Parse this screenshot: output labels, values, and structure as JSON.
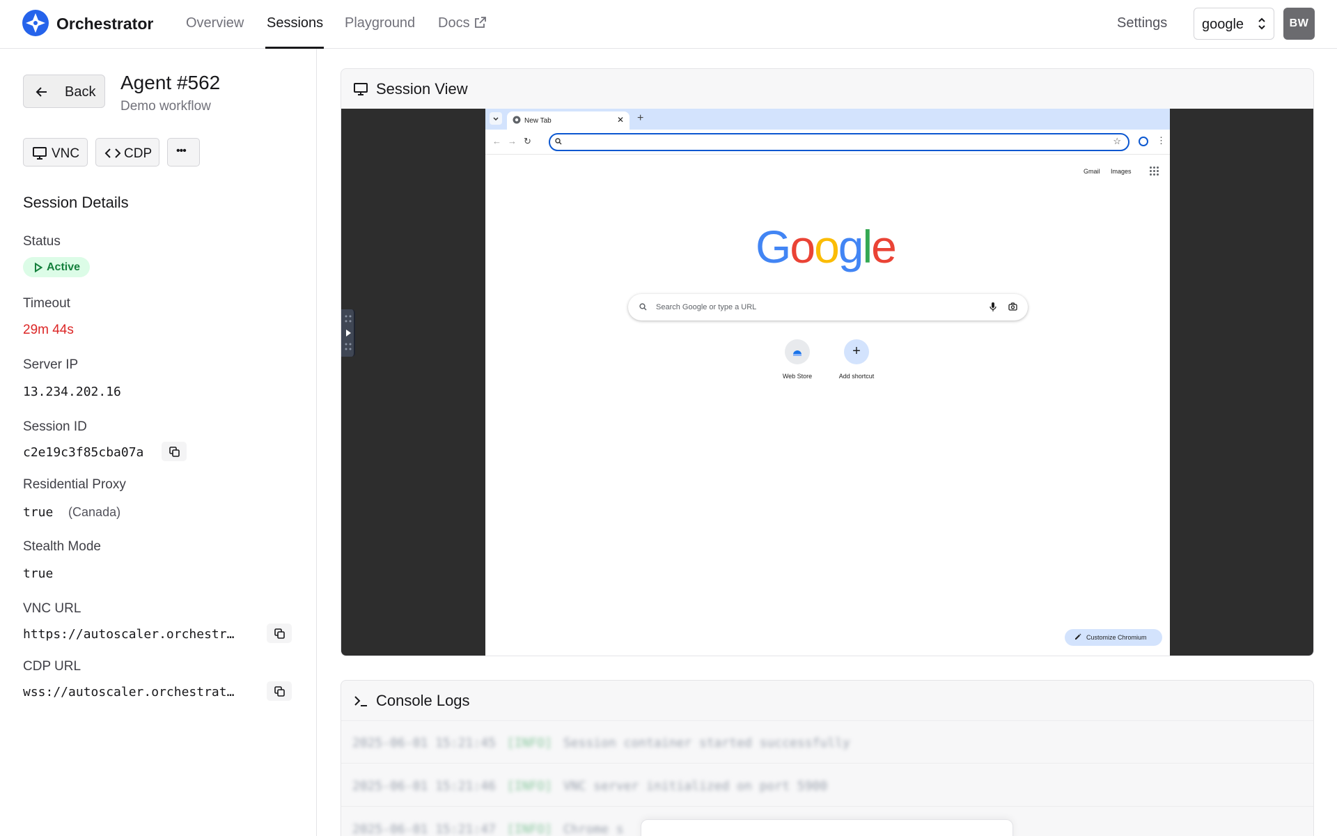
{
  "app": {
    "name": "Orchestrator",
    "brand_color": "#2563eb"
  },
  "nav": {
    "links": [
      {
        "label": "Overview"
      },
      {
        "label": "Sessions"
      },
      {
        "label": "Playground"
      },
      {
        "label": "Docs"
      }
    ],
    "active": "Sessions",
    "settings_label": "Settings",
    "org_select_value": "google",
    "avatar_initials": "BW"
  },
  "sidebar": {
    "back_label": "Back",
    "agent_title": "Agent #562",
    "agent_subtitle": "Demo workflow",
    "tools": {
      "vnc_label": "VNC",
      "cdp_label": "CDP",
      "more_label": "•••"
    },
    "section_title": "Session Details",
    "fields": {
      "status": {
        "label": "Status",
        "value": "Active",
        "color": "#15803d"
      },
      "timeout": {
        "label": "Timeout",
        "value": "29m 44s",
        "color": "#dc2626"
      },
      "server_ip": {
        "label": "Server IP",
        "value": "13.234.202.16"
      },
      "session_id": {
        "label": "Session ID",
        "value": "c2e19c3f85cba07a"
      },
      "proxy": {
        "label": "Residential Proxy",
        "value": "true",
        "note": "(Canada)"
      },
      "stealth": {
        "label": "Stealth Mode",
        "value": "true"
      },
      "vnc_url": {
        "label": "VNC URL",
        "value": "https://autoscaler.orchestr…"
      },
      "cdp_url": {
        "label": "CDP URL",
        "value": "wss://autoscaler.orchestrat…"
      }
    }
  },
  "session_view": {
    "title": "Session View",
    "browser": {
      "tab_title": "New Tab",
      "new_tab_symbol": "+",
      "ntp_links": [
        "Gmail",
        "Images"
      ],
      "logo_letters": [
        {
          "ch": "G",
          "color": "#4285f4"
        },
        {
          "ch": "o",
          "color": "#ea4335"
        },
        {
          "ch": "o",
          "color": "#fbbc05"
        },
        {
          "ch": "g",
          "color": "#4285f4"
        },
        {
          "ch": "l",
          "color": "#34a853"
        },
        {
          "ch": "e",
          "color": "#ea4335"
        }
      ],
      "search_placeholder": "Search Google or type a URL",
      "shortcuts": [
        {
          "label": "Web Store"
        },
        {
          "label": "Add shortcut"
        }
      ],
      "customize_label": "Customize Chromium"
    }
  },
  "console": {
    "title": "Console Logs",
    "lines": [
      {
        "ts": "2025-06-01 15:21:45",
        "level": "[INFO]",
        "msg": "Session container started successfully"
      },
      {
        "ts": "2025-06-01 15:21:46",
        "level": "[INFO]",
        "msg": "VNC server initialized on port 5900"
      },
      {
        "ts": "2025-06-01 15:21:47",
        "level": "[INFO]",
        "msg": "Chrome s"
      }
    ]
  }
}
